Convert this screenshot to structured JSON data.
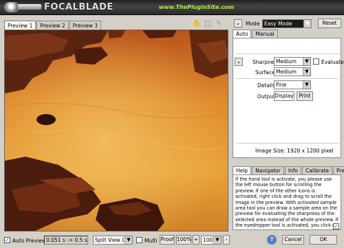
{
  "header": {
    "logo_text": "FOCALBLADE",
    "site_text": "www.ThePluginSite.com"
  },
  "preview_tabs": [
    "Preview 1",
    "Preview 2",
    "Preview 3"
  ],
  "tools": [
    {
      "name": "hand-tool-icon",
      "glyph": "✋"
    },
    {
      "name": "sample-area-tool-icon",
      "glyph": "⬚"
    },
    {
      "name": "eyedropper-tool-icon",
      "glyph": "✎"
    }
  ],
  "mode": {
    "label": "Mode",
    "value": "Easy Mode",
    "reset_label": "Reset"
  },
  "panel_tabs": [
    "Auto",
    "Manual"
  ],
  "auto": {
    "sharpness_label": "Sharpness",
    "sharpness_value": "Medium",
    "evaluate_label": "Evaluate",
    "surface_label": "Surface",
    "surface_value": "Medium",
    "details_label": "Details",
    "details_value": "Fine",
    "output_label": "Output",
    "output_value": "Display",
    "print_label": "Print",
    "image_size": "Image Size:  1920 x 1200 pixel"
  },
  "help_tabs": [
    "Help",
    "Navigator",
    "Info",
    "Calibrate",
    "Prefs"
  ],
  "help_text": "If the hand tool is activate, you please use the left mouse button for scrolling the preview. If one of the other icons is activated, right click and drag to scroll the image in the preview. With activated sample area tool you can draw a sample area on the preview for evaluating the sharpness of the selected area instead of the whole preview. If the eyedropper tool is activated, you click on the preview to select a color to be protected.",
  "bottom": {
    "auto_preview_label": "Auto Preview",
    "timing": "0.051 s -> 0.5 s",
    "split_view_value": "Split View Off",
    "multi_label": "Multi",
    "proof_label": "Proof",
    "zoom_1": "100%",
    "plus_label": "+",
    "zoom_2": "100%",
    "minus_label": "-",
    "cancel_label": "Cancel",
    "ok_label": "OK",
    "help_glyph": "?"
  },
  "colors": {
    "site_text": "#b8e84a",
    "preview_sky": "#e6a13a"
  }
}
